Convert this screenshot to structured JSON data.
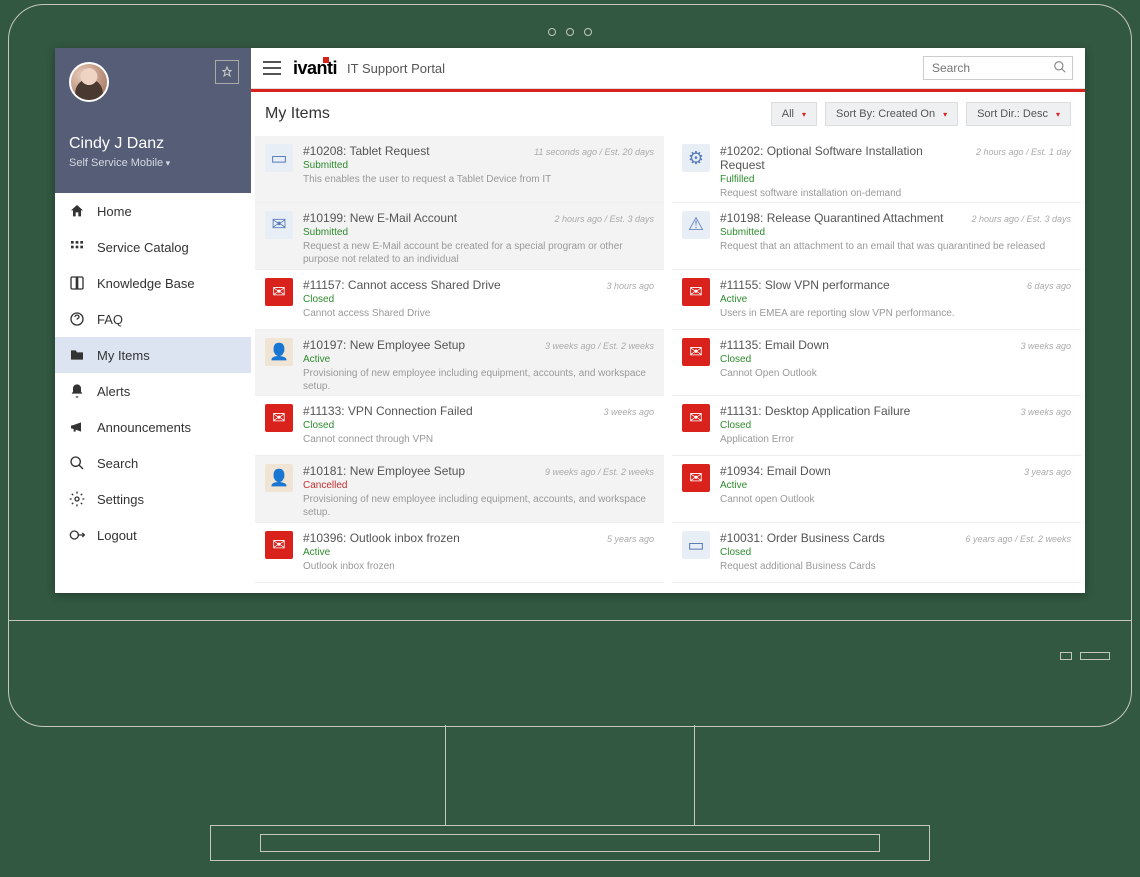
{
  "brand": "ivanti",
  "portal_title": "IT Support Portal",
  "search": {
    "placeholder": "Search"
  },
  "profile": {
    "name": "Cindy J Danz",
    "role": "Self Service Mobile"
  },
  "nav": [
    {
      "icon": "home",
      "label": "Home"
    },
    {
      "icon": "catalog",
      "label": "Service Catalog"
    },
    {
      "icon": "book",
      "label": "Knowledge Base"
    },
    {
      "icon": "faq",
      "label": "FAQ"
    },
    {
      "icon": "folder",
      "label": "My Items",
      "active": true
    },
    {
      "icon": "bell",
      "label": "Alerts"
    },
    {
      "icon": "megaphone",
      "label": "Announcements"
    },
    {
      "icon": "search",
      "label": "Search"
    },
    {
      "icon": "gear",
      "label": "Settings"
    },
    {
      "icon": "logout",
      "label": "Logout"
    }
  ],
  "page_title": "My Items",
  "filters": {
    "scope": "All",
    "sort_by": "Sort By: Created On",
    "sort_dir": "Sort Dir.: Desc"
  },
  "items": [
    {
      "icon": "svc",
      "glyph": "▭",
      "title": "#10208: Tablet Request",
      "status": "Submitted",
      "desc": "This enables the user to request a Tablet Device from IT",
      "time": "11 seconds ago / Est. 20 days",
      "highlight": true
    },
    {
      "icon": "svc",
      "glyph": "⚙",
      "title": "#10202: Optional Software Installation Request",
      "status": "Fulfilled",
      "desc": "Request software installation on-demand",
      "time": "2 hours ago / Est. 1 day"
    },
    {
      "icon": "svc",
      "glyph": "✉",
      "title": "#10199: New E-Mail Account",
      "status": "Submitted",
      "desc": "Request a new E-Mail account be created for a special program or other purpose not related to an individual",
      "time": "2 hours ago / Est. 3 days",
      "highlight": true
    },
    {
      "icon": "svc",
      "glyph": "⚠",
      "title": "#10198: Release Quarantined Attachment",
      "status": "Submitted",
      "desc": "Request that an attachment to an email that was quarantined be released",
      "time": "2 hours ago / Est. 3 days"
    },
    {
      "icon": "red",
      "glyph": "✉",
      "title": "#11157: Cannot access Shared Drive",
      "status": "Closed",
      "desc": "Cannot access Shared Drive",
      "time": "3 hours ago"
    },
    {
      "icon": "red",
      "glyph": "✉",
      "title": "#11155: Slow VPN performance",
      "status": "Active",
      "desc": "Users in EMEA are reporting slow VPN performance.",
      "time": "6 days ago"
    },
    {
      "icon": "person",
      "glyph": "👤",
      "title": "#10197: New Employee Setup",
      "status": "Active",
      "desc": "Provisioning of new employee including equipment, accounts, and workspace setup.",
      "time": "3 weeks ago / Est. 2 weeks",
      "highlight": true
    },
    {
      "icon": "red",
      "glyph": "✉",
      "title": "#11135: Email Down",
      "status": "Closed",
      "desc": "Cannot Open Outlook",
      "time": "3 weeks ago"
    },
    {
      "icon": "red",
      "glyph": "✉",
      "title": "#11133: VPN Connection Failed",
      "status": "Closed",
      "desc": "Cannot connect through VPN",
      "time": "3 weeks ago"
    },
    {
      "icon": "red",
      "glyph": "✉",
      "title": "#11131: Desktop Application Failure",
      "status": "Closed",
      "desc": "Application Error",
      "time": "3 weeks ago"
    },
    {
      "icon": "person",
      "glyph": "👤",
      "title": "#10181: New Employee Setup",
      "status": "Cancelled",
      "desc": "Provisioning of new employee including equipment, accounts, and workspace setup.",
      "time": "9 weeks ago / Est. 2 weeks",
      "highlight": true
    },
    {
      "icon": "red",
      "glyph": "✉",
      "title": "#10934: Email Down",
      "status": "Active",
      "desc": "Cannot open Outlook",
      "time": "3 years ago"
    },
    {
      "icon": "red",
      "glyph": "✉",
      "title": "#10396: Outlook inbox frozen",
      "status": "Active",
      "desc": "Outlook inbox frozen",
      "time": "5 years ago"
    },
    {
      "icon": "svc",
      "glyph": "▭",
      "title": "#10031: Order Business Cards",
      "status": "Closed",
      "desc": "Request additional Business Cards",
      "time": "6 years ago / Est. 2 weeks"
    }
  ]
}
